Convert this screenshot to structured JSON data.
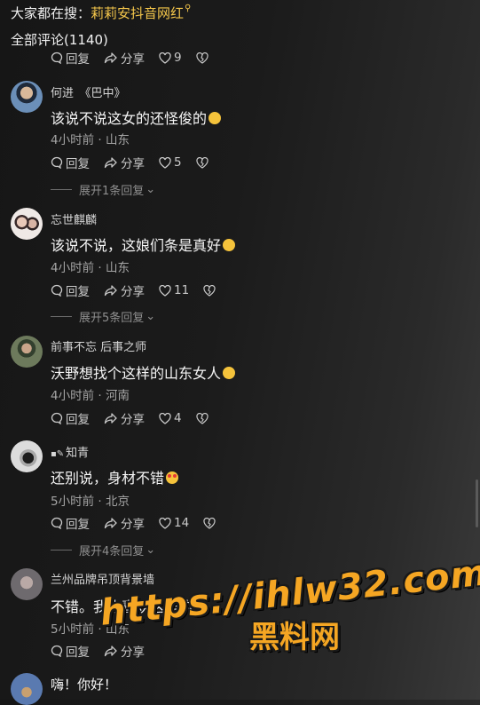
{
  "search": {
    "prefix": "大家都在搜：",
    "keyword": "莉莉安抖音网红",
    "icon": "search-icon"
  },
  "comment_count": "全部评论(1140)",
  "action_labels": {
    "reply": "回复",
    "share": "分享"
  },
  "top_partial": {
    "likes": "9"
  },
  "comments": [
    {
      "name": "何进　《巴中》",
      "text": "该说不说这女的还怪俊的",
      "emoji": "laughing-emoji",
      "meta": "4小时前 · 山东",
      "likes": "5",
      "expand": "展开1条回复"
    },
    {
      "name": "忘世麒麟",
      "text": "该说不说，这娘们条是真好",
      "emoji": "laughing-emoji",
      "meta": "4小时前 · 山东",
      "likes": "11",
      "expand": "展开5条回复"
    },
    {
      "name": "前事不忘 后事之师",
      "text": "沃野想找个这样的山东女人",
      "emoji": "grin-emoji",
      "meta": "4小时前 · 河南",
      "likes": "4",
      "expand": ""
    },
    {
      "name": "知青",
      "name_prefix": "▪✎",
      "text": "还别说，身材不错",
      "emoji": "heart-eyes-emoji",
      "meta": "5小时前 · 北京",
      "likes": "14",
      "expand": "展开4条回复"
    },
    {
      "name": "兰州品牌吊顶背景墙",
      "text": "不错。我也喜欢这样的",
      "emoji": "",
      "meta": "5小时前 · 山东",
      "likes": "",
      "expand": ""
    },
    {
      "name": "",
      "text": "嗨！你好！",
      "emoji": "",
      "meta": "",
      "likes": "",
      "expand": ""
    }
  ],
  "watermark": {
    "url": "https://ihlw32.com",
    "cn": "黑料网"
  }
}
